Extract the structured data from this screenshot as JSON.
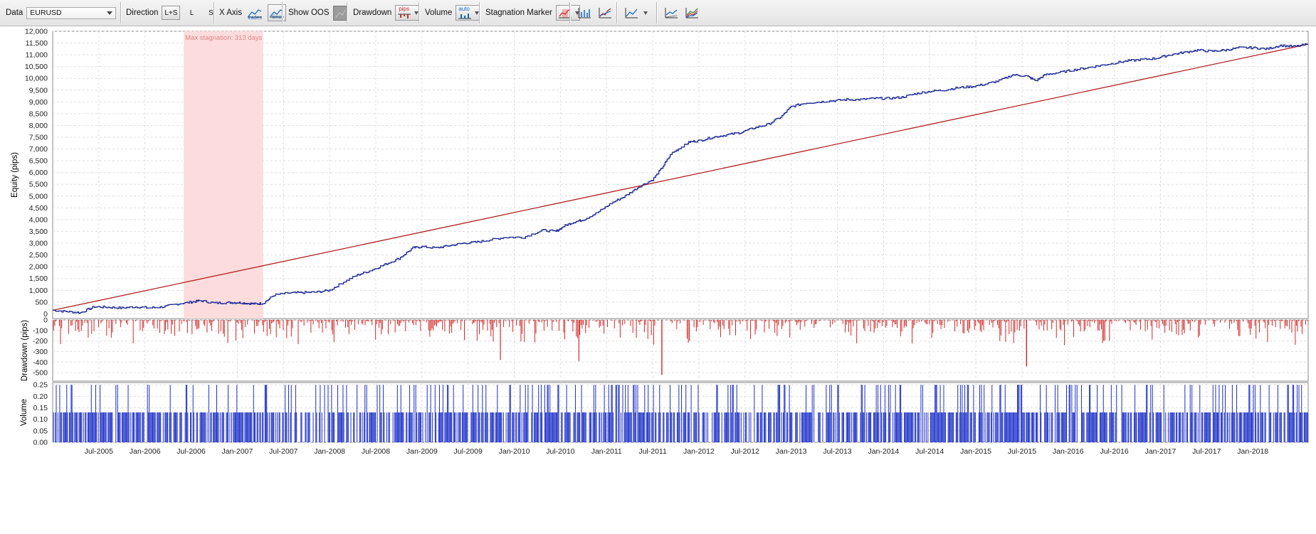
{
  "toolbar": {
    "data_label": "Data",
    "data_value": "EURUSD",
    "direction_label": "Direction",
    "direction_options": [
      "L+S",
      "L",
      "S"
    ],
    "xaxis_label": "X Axis",
    "xaxis_trades_caption": "trades",
    "xaxis_time_caption": "time",
    "show_oos_label": "Show OOS",
    "drawdown_label": "Drawdown",
    "drawdown_unit_caption": "pips",
    "volume_label": "Volume",
    "volume_mode_caption": "auto",
    "stagnation_label": "Stagnation Marker",
    "icons": [
      "chart-bars-icon",
      "chart-equity-icon",
      "line-chart-icon",
      "compare-chart-icon",
      "multi-equity-icon"
    ]
  },
  "colors": {
    "equity_line": "#1e2a96",
    "trend_line": "#b52020",
    "drawdown_bar": "#d02828",
    "volume_bar": "#1c2fc8",
    "stagnation_fill": "#fcdcdc",
    "stagnation_text": "#e08888"
  },
  "chart_data": [
    {
      "type": "line",
      "ylabel": "Equity (pips)",
      "ylim": [
        -200,
        12000
      ],
      "y_ticks": [
        "12,000",
        "11,500",
        "11,000",
        "10,500",
        "10,000",
        "9,500",
        "9,000",
        "8,500",
        "8,000",
        "7,500",
        "7,000",
        "6,500",
        "6,000",
        "5,500",
        "5,000",
        "4,500",
        "4,000",
        "3,500",
        "3,000",
        "2,500",
        "2,000",
        "1,500",
        "1,000",
        "500",
        "0"
      ],
      "y_tick_values": [
        12000,
        11500,
        11000,
        10500,
        10000,
        9500,
        9000,
        8500,
        8000,
        7500,
        7000,
        6500,
        6000,
        5500,
        5000,
        4500,
        4000,
        3500,
        3000,
        2500,
        2000,
        1500,
        1000,
        500,
        0
      ],
      "x_range": [
        2005.0,
        2018.6
      ],
      "annotation": "Max stagnation: 313 days",
      "stagnation_range": [
        2006.42,
        2007.28
      ],
      "series": [
        {
          "type": "step-line",
          "x": [
            2005.0,
            2005.15,
            2005.3,
            2005.45,
            2005.6,
            2005.75,
            2005.9,
            2006.05,
            2006.2,
            2006.35,
            2006.5,
            2006.6,
            2006.75,
            2006.9,
            2007.0,
            2007.1,
            2007.2,
            2007.28,
            2007.4,
            2007.55,
            2007.7,
            2007.85,
            2008.0,
            2008.15,
            2008.3,
            2008.45,
            2008.6,
            2008.75,
            2008.9,
            2009.0,
            2009.15,
            2009.3,
            2009.45,
            2009.6,
            2009.75,
            2009.9,
            2010.1,
            2010.3,
            2010.45,
            2010.55,
            2010.65,
            2010.75,
            2010.9,
            2011.05,
            2011.2,
            2011.35,
            2011.5,
            2011.6,
            2011.7,
            2011.8,
            2011.9,
            2012.0,
            2012.15,
            2012.3,
            2012.45,
            2012.6,
            2012.75,
            2012.9,
            2013.0,
            2013.15,
            2013.3,
            2013.45,
            2013.6,
            2013.75,
            2013.9,
            2014.05,
            2014.2,
            2014.35,
            2014.5,
            2014.65,
            2014.8,
            2014.95,
            2015.1,
            2015.25,
            2015.4,
            2015.55,
            2015.65,
            2015.75,
            2015.9,
            2016.05,
            2016.2,
            2016.35,
            2016.5,
            2016.65,
            2016.8,
            2016.95,
            2017.1,
            2017.25,
            2017.4,
            2017.55,
            2017.7,
            2017.85,
            2018.0,
            2018.15,
            2018.3,
            2018.45,
            2018.6
          ],
          "y": [
            150,
            100,
            50,
            300,
            280,
            250,
            300,
            250,
            300,
            420,
            500,
            560,
            460,
            480,
            480,
            450,
            420,
            450,
            800,
            880,
            900,
            920,
            1000,
            1350,
            1650,
            1850,
            2100,
            2350,
            2800,
            2850,
            2800,
            2900,
            3000,
            3050,
            3150,
            3250,
            3250,
            3550,
            3500,
            3750,
            3900,
            4000,
            4300,
            4700,
            5000,
            5400,
            5700,
            6200,
            6800,
            7050,
            7300,
            7350,
            7500,
            7600,
            7700,
            7900,
            8050,
            8400,
            8800,
            8950,
            9000,
            9050,
            9100,
            9100,
            9150,
            9150,
            9200,
            9350,
            9450,
            9500,
            9600,
            9650,
            9750,
            9900,
            10150,
            10100,
            9900,
            10150,
            10250,
            10350,
            10450,
            10550,
            10650,
            10750,
            10800,
            10850,
            11000,
            11100,
            11200,
            11150,
            11200,
            11300,
            11300,
            11250,
            11400,
            11350,
            11450
          ]
        },
        {
          "type": "trend-line",
          "x": [
            2005.0,
            2018.6
          ],
          "y": [
            150,
            11450
          ]
        }
      ]
    },
    {
      "type": "bar",
      "ylabel": "Drawdown (pips)",
      "ylim": [
        -580,
        0
      ],
      "y_ticks": [
        "0",
        "-100",
        "-200",
        "-300",
        "-400",
        "-500"
      ],
      "y_tick_values": [
        0,
        -100,
        -200,
        -300,
        -400,
        -500
      ],
      "notable_values": [
        {
          "x": 2011.6,
          "y": -520
        },
        {
          "x": 2015.55,
          "y": -440
        },
        {
          "x": 2010.7,
          "y": -390
        },
        {
          "x": 2009.85,
          "y": -380
        }
      ]
    },
    {
      "type": "bar",
      "ylabel": "Volume",
      "ylim": [
        0,
        0.26
      ],
      "y_ticks": [
        "0.25",
        "0.20",
        "0.15",
        "0.10",
        "0.05",
        "0.00"
      ],
      "y_tick_values": [
        0.25,
        0.2,
        0.15,
        0.1,
        0.05,
        0.0
      ],
      "levels": [
        0.13,
        0.25
      ]
    }
  ],
  "x_axis": {
    "tick_labels": [
      "Jul-2005",
      "Jan-2006",
      "Jul-2006",
      "Jan-2007",
      "Jul-2007",
      "Jan-2008",
      "Jul-2008",
      "Jan-2009",
      "Jul-2009",
      "Jan-2010",
      "Jul-2010",
      "Jan-2011",
      "Jul-2011",
      "Jan-2012",
      "Jul-2012",
      "Jan-2013",
      "Jul-2013",
      "Jan-2014",
      "Jul-2014",
      "Jan-2015",
      "Jul-2015",
      "Jan-2016",
      "Jul-2016",
      "Jan-2017",
      "Jul-2017",
      "Jan-2018"
    ],
    "tick_values": [
      2005.5,
      2006.0,
      2006.5,
      2007.0,
      2007.5,
      2008.0,
      2008.5,
      2009.0,
      2009.5,
      2010.0,
      2010.5,
      2011.0,
      2011.5,
      2012.0,
      2012.5,
      2013.0,
      2013.5,
      2014.0,
      2014.5,
      2015.0,
      2015.5,
      2016.0,
      2016.5,
      2017.0,
      2017.5,
      2018.0
    ]
  }
}
